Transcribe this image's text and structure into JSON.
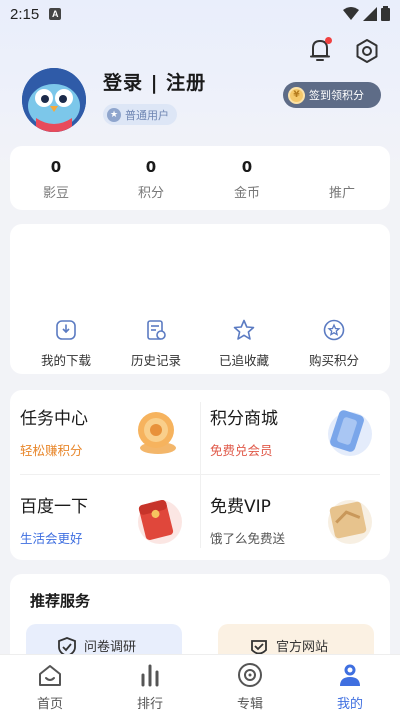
{
  "status_bar": {
    "time": "2:15",
    "notif_badge": "A"
  },
  "profile": {
    "title": "登录 | 注册",
    "level": "普通用户",
    "checkin_label": "签到领积分"
  },
  "stats": [
    {
      "value": "0",
      "label": "影豆"
    },
    {
      "value": "0",
      "label": "积分"
    },
    {
      "value": "0",
      "label": "金币"
    },
    {
      "value": "",
      "label": "推广"
    }
  ],
  "tools": [
    {
      "label": "我的下载",
      "icon": "download-icon"
    },
    {
      "label": "历史记录",
      "icon": "history-icon"
    },
    {
      "label": "已追收藏",
      "icon": "star-icon"
    },
    {
      "label": "购买积分",
      "icon": "points-icon"
    }
  ],
  "grid": [
    {
      "title": "任务中心",
      "subtitle": "轻松赚积分",
      "subtitle_color": "#e8862a",
      "icon": "coin-stack-icon"
    },
    {
      "title": "积分商城",
      "subtitle": "免费兑会员",
      "subtitle_color": "#e05a4a",
      "icon": "shop-card-icon"
    },
    {
      "title": "百度一下",
      "subtitle": "生活会更好",
      "subtitle_color": "#3f6fe0",
      "icon": "red-packet-icon"
    },
    {
      "title": "免费VIP",
      "subtitle": "饿了么免费送",
      "subtitle_color": "#555555",
      "icon": "gift-box-icon"
    }
  ],
  "recommend": {
    "title": "推荐服务",
    "items": [
      {
        "label": "问卷调研",
        "bg": "#e8eefc"
      },
      {
        "label": "官方网站",
        "bg": "#fbf1e3"
      }
    ]
  },
  "nav": [
    {
      "label": "首页",
      "icon": "home-icon"
    },
    {
      "label": "排行",
      "icon": "rank-icon"
    },
    {
      "label": "专辑",
      "icon": "album-icon"
    },
    {
      "label": "我的",
      "icon": "profile-icon",
      "active": true
    }
  ],
  "colors": {
    "accent": "#3f6fe0",
    "background": "#f2f3f7"
  }
}
